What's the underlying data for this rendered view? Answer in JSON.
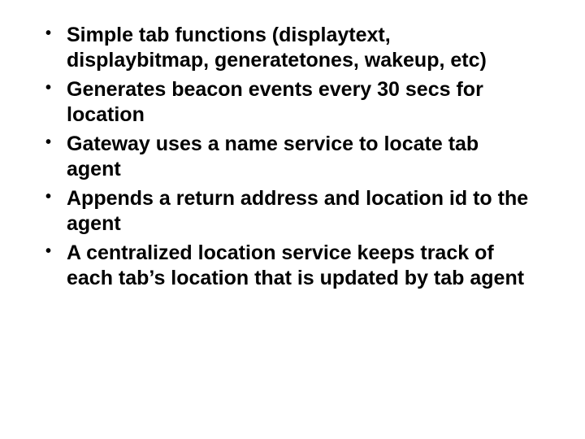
{
  "bullets": [
    "Simple tab functions (displaytext, displaybitmap, generatetones, wakeup, etc)",
    "Generates beacon events every 30 secs for location",
    "Gateway uses a name service to locate tab agent",
    "Appends a return address and location id to the agent",
    "A centralized location service keeps track of each tab’s location that is updated by tab agent"
  ]
}
